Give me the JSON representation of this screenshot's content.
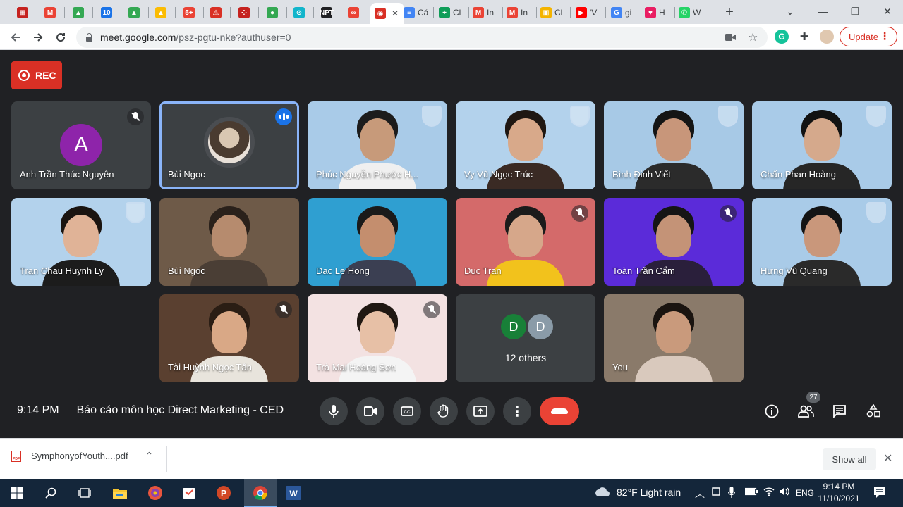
{
  "browser": {
    "tabs": [
      {
        "title": "",
        "color": "#c5221f",
        "glyph": "▦"
      },
      {
        "title": "",
        "color": "#ea4335",
        "glyph": "M"
      },
      {
        "title": "",
        "color": "#34a853",
        "glyph": "▲"
      },
      {
        "title": "",
        "color": "#1a73e8",
        "glyph": "10"
      },
      {
        "title": "",
        "color": "#34a853",
        "glyph": "▲"
      },
      {
        "title": "",
        "color": "#fbbc04",
        "glyph": "▲"
      },
      {
        "title": "",
        "color": "#ea4335",
        "glyph": "5+"
      },
      {
        "title": "",
        "color": "#d93025",
        "glyph": "⚠"
      },
      {
        "title": "",
        "color": "#c5221f",
        "glyph": "⁘"
      },
      {
        "title": "",
        "color": "#34a853",
        "glyph": "●"
      },
      {
        "title": "",
        "color": "#12b5cb",
        "glyph": "⊘"
      },
      {
        "title": "",
        "color": "#202124",
        "glyph": "NPT"
      },
      {
        "title": "",
        "color": "#ea4335",
        "glyph": "∞"
      },
      {
        "title": "",
        "color": "#d93025",
        "glyph": "◉"
      },
      {
        "title": "Cá",
        "color": "#4285f4",
        "glyph": "≡"
      },
      {
        "title": "Cl",
        "color": "#0f9d58",
        "glyph": "+"
      },
      {
        "title": "In",
        "color": "#ea4335",
        "glyph": "M"
      },
      {
        "title": "In",
        "color": "#ea4335",
        "glyph": "M"
      },
      {
        "title": "Cl",
        "color": "#f4b400",
        "glyph": "▣"
      },
      {
        "title": "'V",
        "color": "#ff0000",
        "glyph": "▶"
      },
      {
        "title": "gi",
        "color": "#4285f4",
        "glyph": "G"
      },
      {
        "title": "H",
        "color": "#e91e63",
        "glyph": "♥"
      },
      {
        "title": "W",
        "color": "#25d366",
        "glyph": "✆"
      }
    ],
    "active_tab_close": "✕",
    "new_tab": "+",
    "url_host": "meet.google.com",
    "url_path": "/psz-pgtu-nke?authuser=0",
    "update_label": "Update",
    "window_controls": {
      "minimize": "—",
      "restore": "❐",
      "close": "✕",
      "dropdown": "⌄"
    }
  },
  "meet": {
    "rec_label": "REC",
    "tiles": [
      {
        "name": "Anh Trần Thúc Nguyên",
        "type": "letter",
        "letter": "A",
        "mic_off": true
      },
      {
        "name": "Bùi Ngọc",
        "type": "photo",
        "speaking": true
      },
      {
        "name": "Phúc Nguyễn Phước H...",
        "type": "video",
        "bg": "#a9cbe8",
        "skin": "#c79a7a",
        "shirt": "#f0f0f0",
        "hair": "#1c1c1c",
        "shield": true
      },
      {
        "name": "Vy Vũ Ngọc Trúc",
        "type": "video",
        "bg": "#b3d2ec",
        "skin": "#d8a98a",
        "shirt": "#3a2a24",
        "hair": "#1f1712",
        "shield": true
      },
      {
        "name": "Bình Đinh Viết",
        "type": "video",
        "bg": "#a7c9e6",
        "skin": "#c8967a",
        "shirt": "#2b2b2b",
        "hair": "#151515",
        "shield": true
      },
      {
        "name": "Chấn Phan Hoàng",
        "type": "video",
        "bg": "#a9cbe8",
        "skin": "#d5a98c",
        "shirt": "#262626",
        "hair": "#121212",
        "shield": true
      },
      {
        "name": "Tran Chau Huynh Ly",
        "type": "video",
        "bg": "#b3d2ec",
        "skin": "#e0b397",
        "shirt": "#1c1c1c",
        "hair": "#1a1410",
        "shield": true
      },
      {
        "name": "Bùi Ngọc",
        "type": "video",
        "bg": "#6e5a48",
        "skin": "#b68b6e",
        "shirt": "#4a3e35",
        "hair": "#2a211b"
      },
      {
        "name": "Dac Le Hong",
        "type": "video",
        "bg": "#2f9fd1",
        "skin": "#c48e6e",
        "shirt": "#3b3f52",
        "hair": "#1a1a1a"
      },
      {
        "name": "Duc Tran",
        "type": "video",
        "bg": "#d46a6a",
        "skin": "#d6a78a",
        "shirt": "#f2c21c",
        "hair": "#1b1b1b",
        "mic_off": true
      },
      {
        "name": "Toàn Trần Cẩm",
        "type": "video",
        "bg": "#5b2bd9",
        "skin": "#c49377",
        "shirt": "#2a1f3b",
        "hair": "#151515",
        "mic_off": true
      },
      {
        "name": "Hưng Vũ Quang",
        "type": "video",
        "bg": "#a9cbe8",
        "skin": "#c9977b",
        "shirt": "#2a2a2a",
        "hair": "#141414",
        "shield": true
      },
      {
        "name": "Tài Huỳnh Ngọc Tấn",
        "type": "video",
        "bg": "#5a4030",
        "skin": "#d9a886",
        "shirt": "#e8e4dc",
        "hair": "#2a1d14",
        "mic_off": true
      },
      {
        "name": "Trà Mai Hoàng Sơn",
        "type": "video",
        "bg": "#f3e2e2",
        "skin": "#e7c0a6",
        "shirt": "#f4f4f4",
        "hair": "#201812",
        "mic_off": true
      },
      {
        "name": "",
        "type": "others",
        "avatars": [
          {
            "letter": "D",
            "color": "#188038"
          },
          {
            "letter": "D",
            "color": "#8a9ba8"
          }
        ],
        "others_label": "12 others"
      },
      {
        "name": "You",
        "type": "video",
        "bg": "#8a7a6a",
        "skin": "#c99a7c",
        "shirt": "#d9c9bd",
        "hair": "#1a1410"
      }
    ],
    "time": "9:14 PM",
    "meeting_title": "Báo cáo môn học Direct Marketing - CED",
    "participant_count": "27"
  },
  "downloads": {
    "file_name": "SymphonyofYouth....pdf",
    "file_badge": "PDF",
    "chevron": "⌃",
    "show_all": "Show all",
    "close": "✕"
  },
  "taskbar": {
    "weather": "82°F  Light rain",
    "language": "ENG",
    "time": "9:14 PM",
    "date": "11/10/2021"
  }
}
